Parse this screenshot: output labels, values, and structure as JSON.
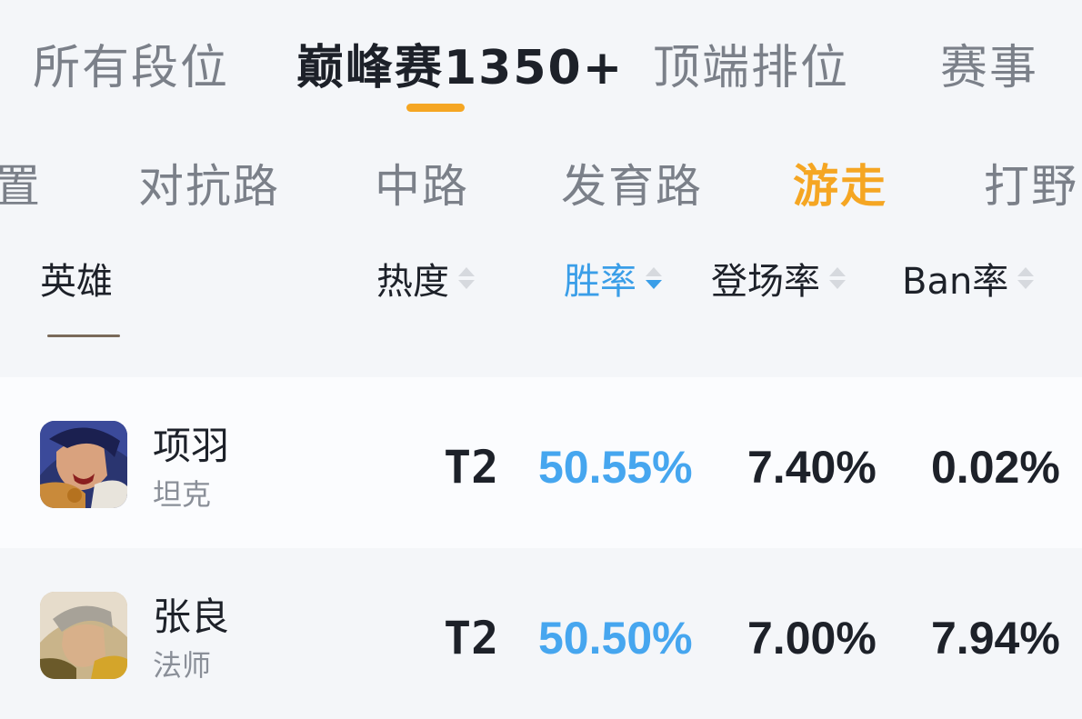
{
  "top_tabs": [
    {
      "label": "所有段位"
    },
    {
      "label": "巅峰赛1350+"
    },
    {
      "label": "顶端排位"
    },
    {
      "label": "赛事"
    }
  ],
  "active_top_tab": "巅峰赛1350+",
  "positions": [
    {
      "label": "置"
    },
    {
      "label": "对抗路"
    },
    {
      "label": "中路"
    },
    {
      "label": "发育路"
    },
    {
      "label": "游走"
    },
    {
      "label": "打野"
    }
  ],
  "active_position": "游走",
  "headers": {
    "hero": "英雄",
    "heat": "热度",
    "win_rate": "胜率",
    "pick_rate": "登场率",
    "ban_rate": "Ban率"
  },
  "sorted_by": "胜率",
  "rows": [
    {
      "name": "项羽",
      "role": "坦克",
      "tier": "T2",
      "win_rate": "50.55%",
      "pick_rate": "7.40%",
      "ban_rate": "0.02%"
    },
    {
      "name": "张良",
      "role": "法师",
      "tier": "T2",
      "win_rate": "50.50%",
      "pick_rate": "7.00%",
      "ban_rate": "7.94%"
    }
  ],
  "colors": {
    "accent_orange": "#f5a623",
    "accent_blue": "#3a9ee8",
    "text_dark": "#1d2129",
    "text_gray": "#7b8089"
  }
}
